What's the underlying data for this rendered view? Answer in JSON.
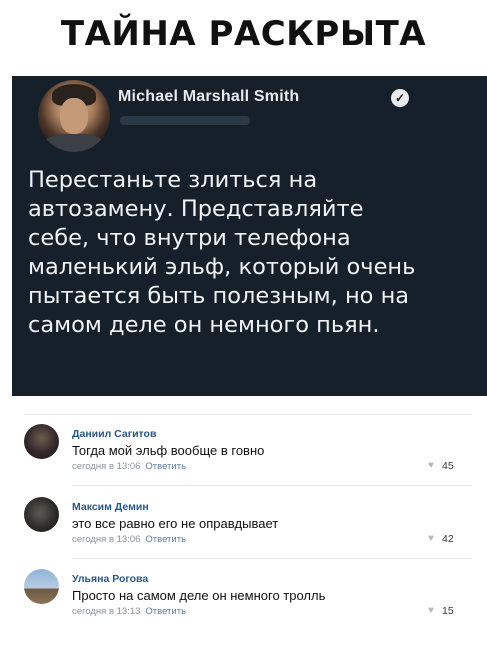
{
  "meme": {
    "title": "ТАЙНА РАСКРЫТА"
  },
  "tweet": {
    "author_name": "Michael Marshall Smith",
    "verified_icon": "check-badge",
    "text_lines": [
      "Перестаньте злиться на",
      "автозамену. Представляйте",
      "себе, что внутри телефона",
      "маленький эльф, который очень",
      "пытается быть полезным, но на",
      "самом деле он немного пьян."
    ]
  },
  "comments": [
    {
      "name": "Даниил Сагитов",
      "text": "Тогда мой эльф вообще в говно",
      "time": "сегодня в 13:06",
      "reply": "Ответить",
      "likes": "45"
    },
    {
      "name": "Максим Демин",
      "text": "это все равно его не оправдывает",
      "time": "сегодня в 13:06",
      "reply": "Ответить",
      "likes": "42"
    },
    {
      "name": "Ульяна Рогова",
      "text": "Просто на самом деле он немного тролль",
      "time": "сегодня в 13:13",
      "reply": "Ответить",
      "likes": "15"
    }
  ],
  "colors": {
    "tweet_background": "#15202b",
    "comment_name": "#2a5885",
    "meta_text": "#8a939d"
  }
}
